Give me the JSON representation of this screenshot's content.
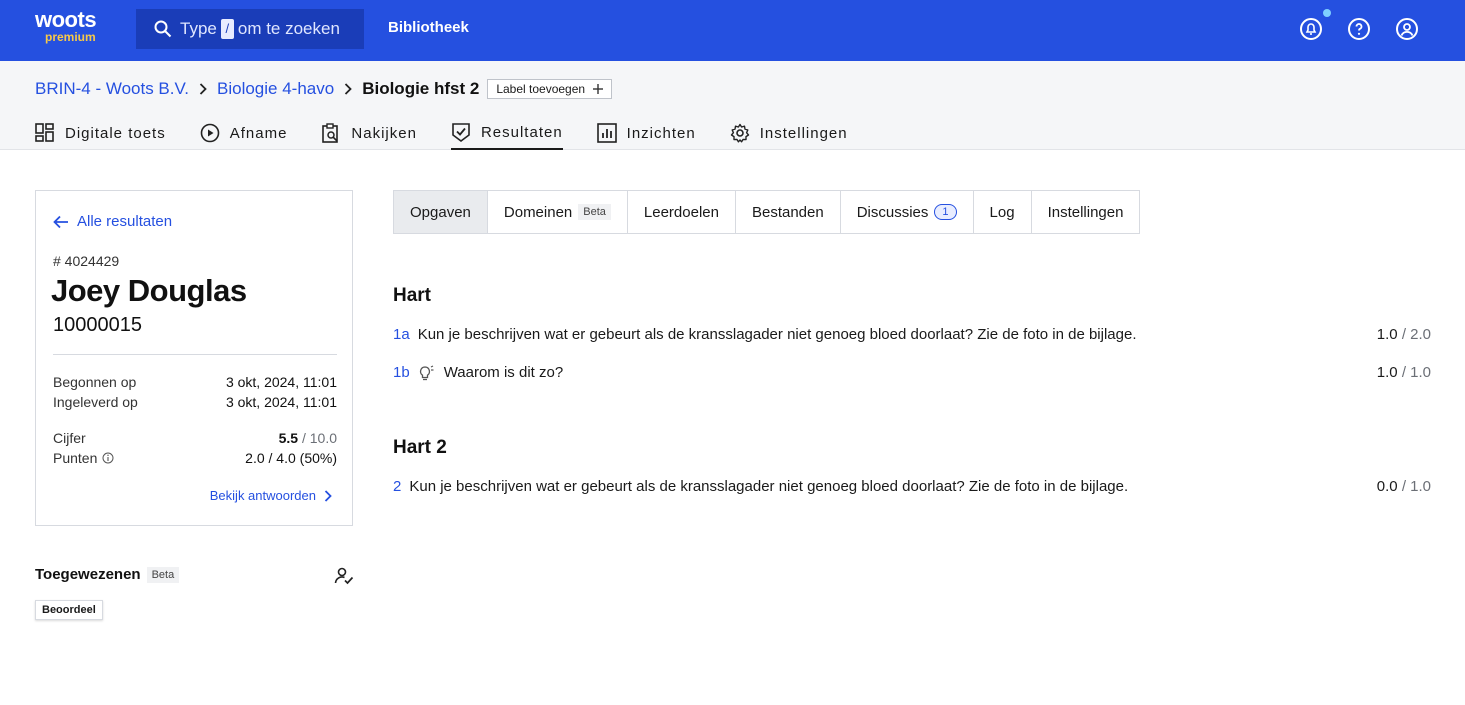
{
  "topbar": {
    "logo_text": "woots",
    "logo_sub": "premium",
    "search_prefix": "Type",
    "search_key": "/",
    "search_suffix": "om te zoeken",
    "library": "Bibliotheek"
  },
  "breadcrumb": {
    "org": "BRIN-4 - Woots B.V.",
    "course": "Biologie 4-havo",
    "current": "Biologie hfst 2",
    "label_button": "Label toevoegen"
  },
  "nav": {
    "digitale_toets": "Digitale toets",
    "afname": "Afname",
    "nakijken": "Nakijken",
    "resultaten": "Resultaten",
    "inzichten": "Inzichten",
    "instellingen": "Instellingen"
  },
  "candidate": {
    "back": "Alle resultaten",
    "number": "# 4024429",
    "name": "Joey Douglas",
    "student_id": "10000015",
    "begonnen_label": "Begonnen op",
    "begonnen_value": "3 okt, 2024, 11:01",
    "ingeleverd_label": "Ingeleverd op",
    "ingeleverd_value": "3 okt, 2024, 11:01",
    "cijfer_label": "Cijfer",
    "cijfer_value": "5.5",
    "cijfer_max": "/ 10.0",
    "punten_label": "Punten",
    "punten_value": "2.0 / 4.0 (50%)",
    "bekijk": "Bekijk antwoorden"
  },
  "assigned": {
    "title": "Toegewezenen",
    "beta": "Beta",
    "tag": "Beoordeel"
  },
  "tabs": {
    "opgaven": "Opgaven",
    "domeinen": "Domeinen",
    "domeinen_badge": "Beta",
    "leerdoelen": "Leerdoelen",
    "bestanden": "Bestanden",
    "discussies": "Discussies",
    "discussies_count": "1",
    "log": "Log",
    "instellingen": "Instellingen"
  },
  "sections": [
    {
      "title": "Hart",
      "questions": [
        {
          "num": "1a",
          "text": "Kun je beschrijven wat er gebeurt als de kransslagader niet genoeg bloed doorlaat? Zie de foto in de bijlage.",
          "score": "1.0",
          "max": "/ 2.0"
        },
        {
          "num": "1b",
          "text": "Waarom is dit zo?",
          "score": "1.0",
          "max": "/ 1.0"
        }
      ]
    },
    {
      "title": "Hart 2",
      "questions": [
        {
          "num": "2",
          "text": "Kun je beschrijven wat er gebeurt als de kransslagader niet genoeg bloed doorlaat? Zie de foto in de bijlage.",
          "score": "0.0",
          "max": "/ 1.0"
        }
      ]
    }
  ],
  "colors": {
    "brand": "#2550e0",
    "accent_yellow": "#f7c948"
  }
}
